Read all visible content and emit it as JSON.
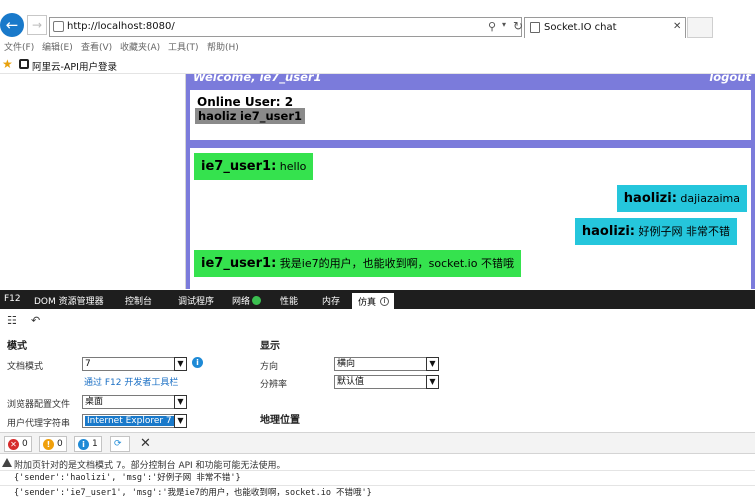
{
  "browser": {
    "url": "http://localhost:8080/",
    "tab_title": "Socket.IO chat",
    "menu": [
      "文件(F)",
      "编辑(E)",
      "查看(V)",
      "收藏夹(A)",
      "工具(T)",
      "帮助(H)"
    ],
    "favorites": [
      "阿里云-API用户登录"
    ]
  },
  "chat": {
    "welcome": "Welcome, ie7_user1",
    "logout": "logout",
    "online_label": "Online User: 2",
    "online_users": [
      "haolizi",
      "ie7_user1"
    ],
    "messages": [
      {
        "sender": "ie7_user1:",
        "text": "hello",
        "side": "left"
      },
      {
        "sender": "haolizi:",
        "text": "dajiazaima",
        "side": "right"
      },
      {
        "sender": "haolizi:",
        "text": "好例子网 非常不错",
        "side": "right"
      },
      {
        "sender": "ie7_user1:",
        "text": "我是ie7的用户，也能收到啊，socket.io 不错哦",
        "side": "left"
      }
    ]
  },
  "devtools": {
    "tabs": [
      "F12",
      "DOM 资源管理器",
      "控制台",
      "调试程序",
      "网络",
      "性能",
      "内存",
      "仿真"
    ],
    "active_tab": "仿真",
    "mode": {
      "heading": "模式",
      "doc_mode_label": "文档模式",
      "doc_mode_value": "7",
      "devtools_link": "通过 F12 开发者工具栏",
      "browser_profile_label": "浏览器配置文件",
      "browser_profile_value": "桌面",
      "ua_label": "用户代理字符串",
      "ua_value": "Internet Explorer 7"
    },
    "display": {
      "heading": "显示",
      "orientation_label": "方向",
      "orientation_value": "横向",
      "resolution_label": "分辨率",
      "resolution_value": "默认值"
    },
    "geo_heading": "地理位置",
    "console": {
      "errors": "0",
      "warnings": "0",
      "messages": "1",
      "warning_text": "附加页针对的是文档模式 7。部分控制台 API 和功能可能无法使用。",
      "logs": [
        "{'sender':'haolizi', 'msg':'好例子网 非常不错'}",
        "{'sender':'ie7_user1', 'msg':'我是ie7的用户，也能收到啊，socket.io 不错哦'}"
      ]
    }
  },
  "colors": {
    "chat_panel": "#7b7bdb",
    "msg_left": "#35e24e",
    "msg_right": "#25c6dc",
    "user_tag": "#8a8a8a",
    "f12_bar": "#1e1e1e"
  }
}
